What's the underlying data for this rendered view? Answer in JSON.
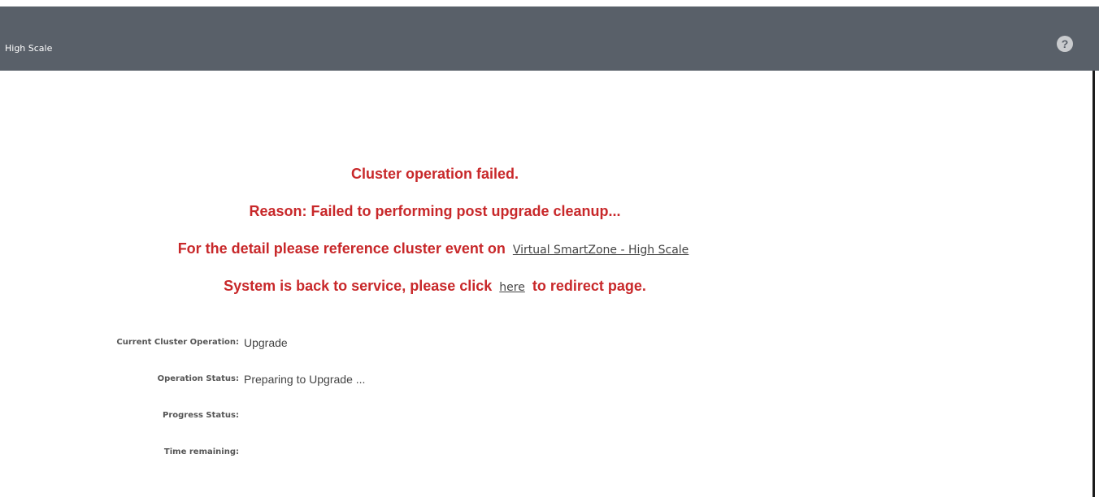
{
  "header": {
    "title": "High Scale",
    "help_icon": "help-icon",
    "background_color": "#596069"
  },
  "messages": {
    "line1": "Cluster operation failed.",
    "line2": "Reason: Failed to performing post upgrade cleanup...",
    "line3_prefix": "For the detail please reference cluster event on",
    "line3_link": "Virtual SmartZone - High Scale",
    "line4_prefix": "System is back to service, please click",
    "line4_link": "here",
    "line4_suffix": "to redirect page.",
    "color": "#c8282a"
  },
  "status": {
    "current_operation_label": "Current Cluster Operation:",
    "current_operation_value": "Upgrade",
    "operation_status_label": "Operation Status:",
    "operation_status_value": "Preparing to Upgrade ...",
    "progress_status_label": "Progress Status:",
    "progress_status_value": "",
    "time_remaining_label": "Time remaining:",
    "time_remaining_value": ""
  }
}
